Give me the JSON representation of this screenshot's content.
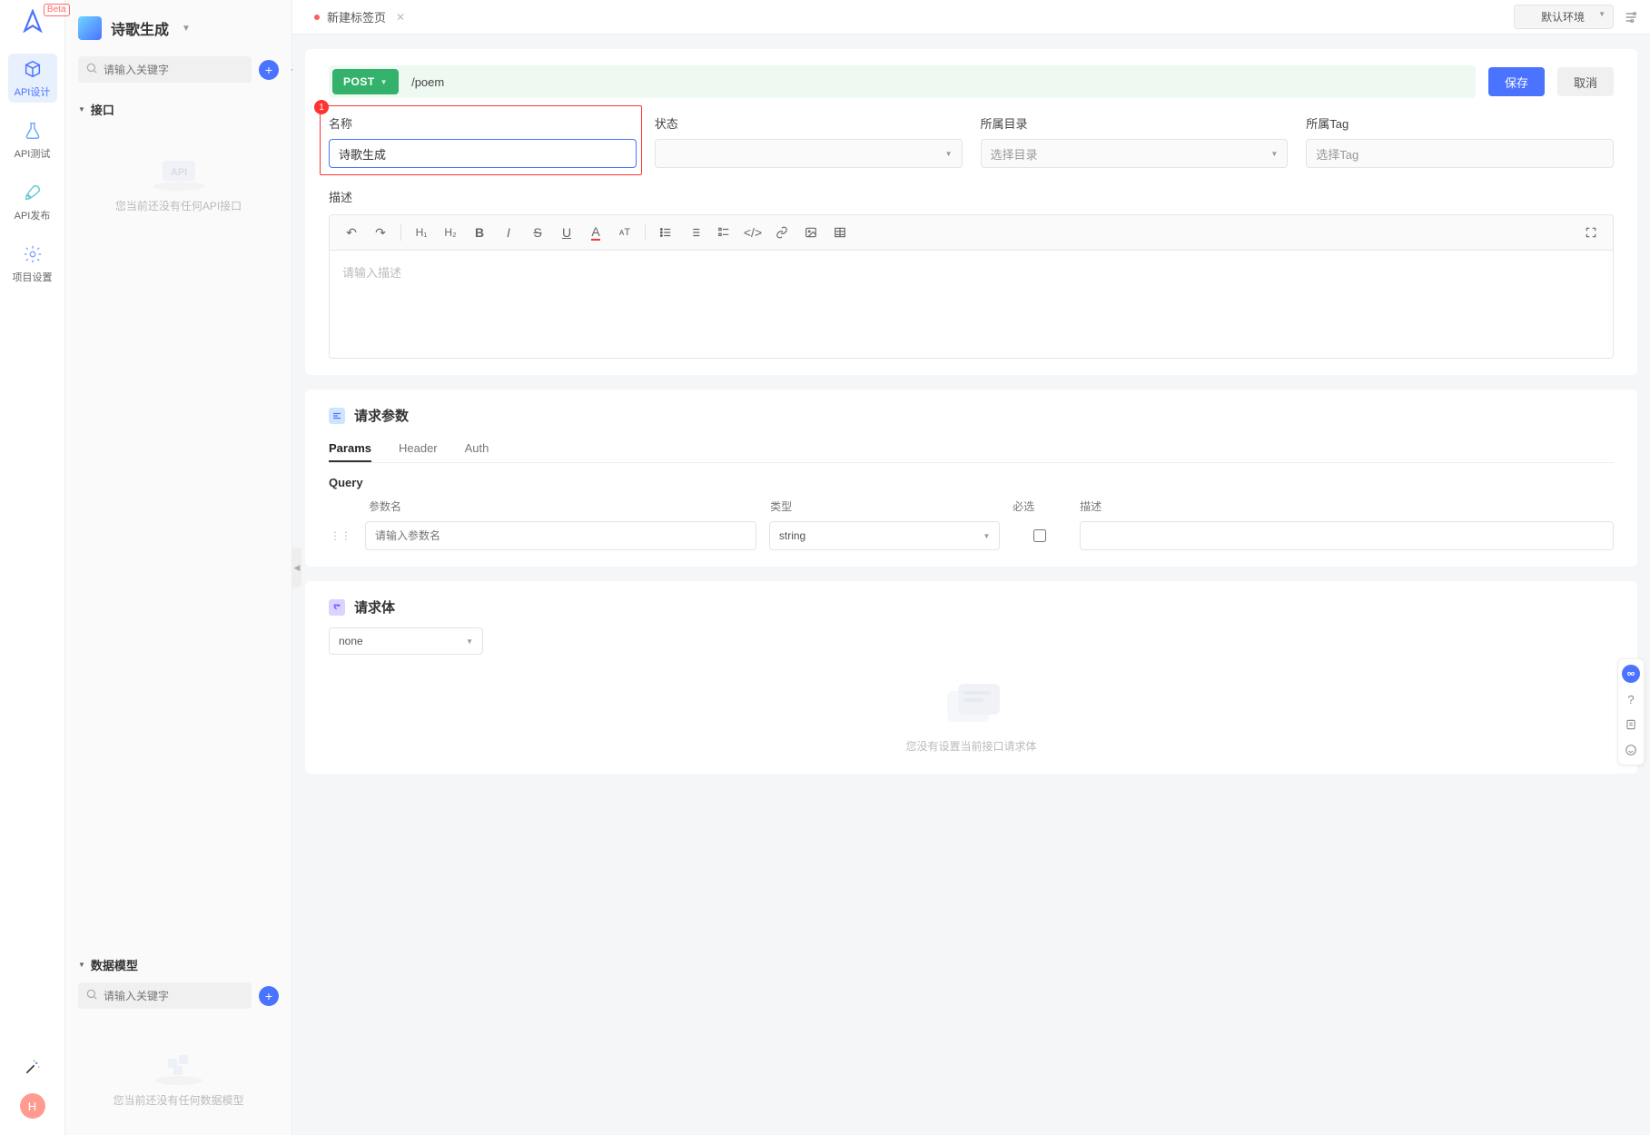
{
  "logo": {
    "beta": "Beta"
  },
  "rail": {
    "items": [
      {
        "label": "API设计"
      },
      {
        "label": "API测试"
      },
      {
        "label": "API发布"
      },
      {
        "label": "项目设置"
      }
    ],
    "avatar_letter": "H"
  },
  "project": {
    "name": "诗歌生成"
  },
  "sidebar": {
    "search_placeholder_1": "请输入关键字",
    "section_interfaces": "接口",
    "empty_interfaces": "您当前还没有任何API接口",
    "section_models": "数据模型",
    "search_placeholder_2": "请输入关键字",
    "empty_models": "您当前还没有任何数据模型"
  },
  "tabs": {
    "new_tab": "新建标签页"
  },
  "env": {
    "selected": "默认环境"
  },
  "request": {
    "method": "POST",
    "path": "/poem",
    "save": "保存",
    "cancel": "取消"
  },
  "meta": {
    "name_label": "名称",
    "name_value": "诗歌生成",
    "badge": "1",
    "status_label": "状态",
    "dir_label": "所属目录",
    "dir_placeholder": "选择目录",
    "tag_label": "所属Tag",
    "tag_placeholder": "选择Tag"
  },
  "desc": {
    "label": "描述",
    "placeholder": "请输入描述"
  },
  "params": {
    "title": "请求参数",
    "tabs": {
      "params": "Params",
      "header": "Header",
      "auth": "Auth"
    },
    "query_label": "Query",
    "cols": {
      "name": "参数名",
      "type": "类型",
      "required": "必选",
      "desc": "描述"
    },
    "row": {
      "name_placeholder": "请输入参数名",
      "type_value": "string"
    }
  },
  "body": {
    "title": "请求体",
    "type": "none",
    "empty_text": "您没有设置当前接口请求体"
  }
}
